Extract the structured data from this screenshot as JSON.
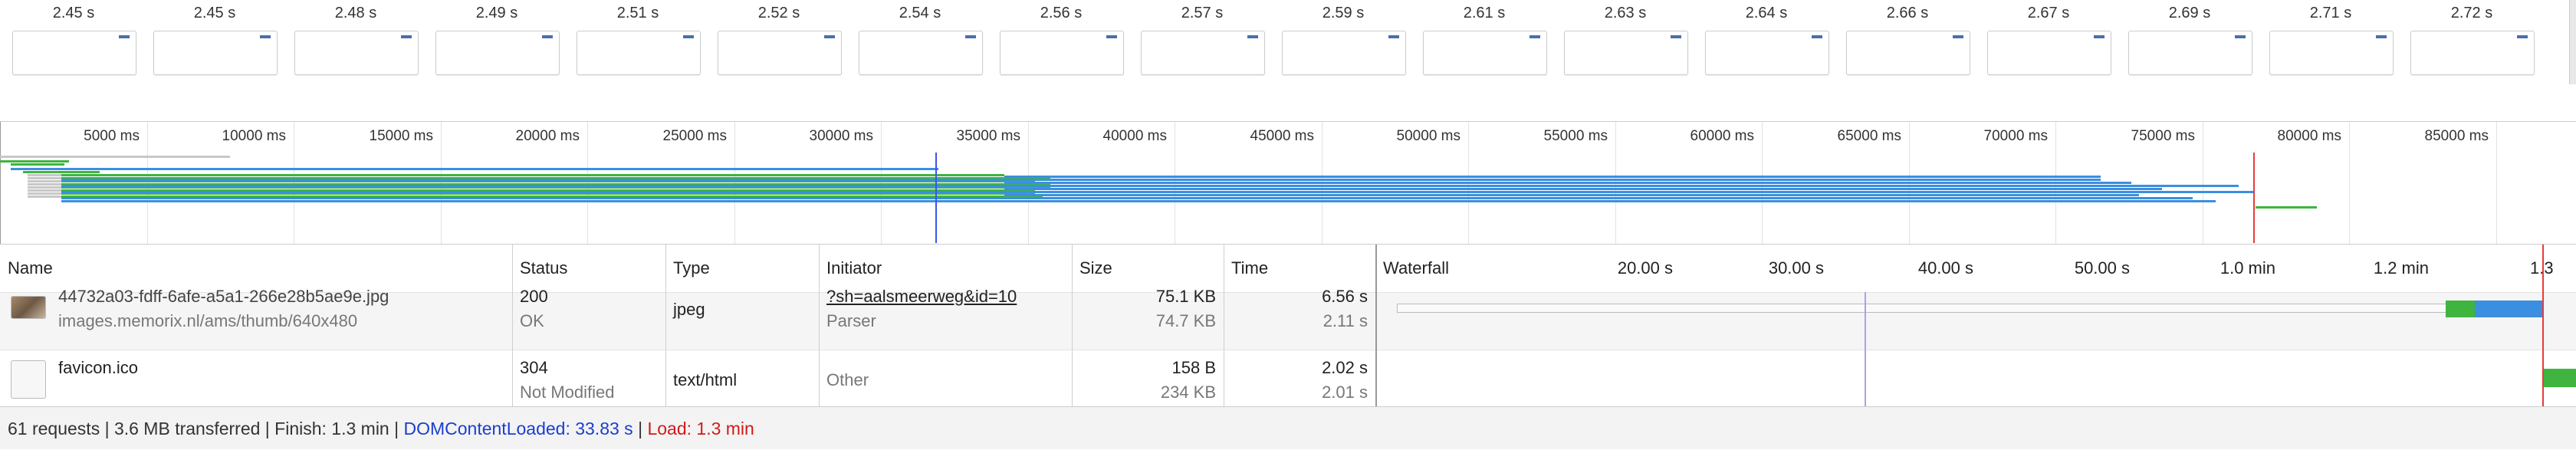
{
  "filmstrip": {
    "frames": [
      "2.45 s",
      "2.45 s",
      "2.48 s",
      "2.49 s",
      "2.51 s",
      "2.52 s",
      "2.54 s",
      "2.56 s",
      "2.57 s",
      "2.59 s",
      "2.61 s",
      "2.63 s",
      "2.64 s",
      "2.66 s",
      "2.67 s",
      "2.69 s",
      "2.71 s",
      "2.72 s"
    ]
  },
  "overview": {
    "tick_labels": [
      "5000 ms",
      "10000 ms",
      "15000 ms",
      "20000 ms",
      "25000 ms",
      "30000 ms",
      "35000 ms",
      "40000 ms",
      "45000 ms",
      "50000 ms",
      "55000 ms",
      "60000 ms",
      "65000 ms",
      "70000 ms",
      "75000 ms",
      "80000 ms",
      "85000 ms"
    ],
    "colors": {
      "queued": "#c8c8c8",
      "waiting": "#3fb53f",
      "download": "#3b8fe0",
      "dom_line": "#3b56e8",
      "load_line": "#e83b3b"
    }
  },
  "table": {
    "headers": {
      "name": "Name",
      "status": "Status",
      "type": "Type",
      "initiator": "Initiator",
      "size": "Size",
      "time": "Time",
      "waterfall": "Waterfall"
    },
    "waterfall_ticks": [
      "20.00 s",
      "30.00 s",
      "40.00 s",
      "50.00 s",
      "1.0 min",
      "1.2 min",
      "1.3 min"
    ],
    "rows": [
      {
        "name": "44732a03-fdff-6afe-a5a1-266e28b5ae9e.jpg",
        "domain": "images.memorix.nl/ams/thumb/640x480",
        "status_code": "200",
        "status_text": "OK",
        "type": "jpeg",
        "initiator": "?sh=aalsmeerweg&id=10",
        "initiator_sub": "Parser",
        "size": "75.1 KB",
        "size_sub": "74.7 KB",
        "time": "6.56 s",
        "time_sub": "2.11 s",
        "icon": "image-thumbnail-icon"
      },
      {
        "name": "favicon.ico",
        "domain": "",
        "status_code": "304",
        "status_text": "Not Modified",
        "type": "text/html",
        "initiator": "Other",
        "initiator_sub": "",
        "size": "158 B",
        "size_sub": "234 KB",
        "time": "2.02 s",
        "time_sub": "2.01 s",
        "icon": "blank-file-icon"
      }
    ]
  },
  "status_bar": {
    "summary": "61 requests | 3.6 MB transferred | Finish: 1.3 min | ",
    "dom_content_loaded": "DOMContentLoaded: 33.83 s",
    "separator": " | ",
    "load": "Load: 1.3 min"
  }
}
